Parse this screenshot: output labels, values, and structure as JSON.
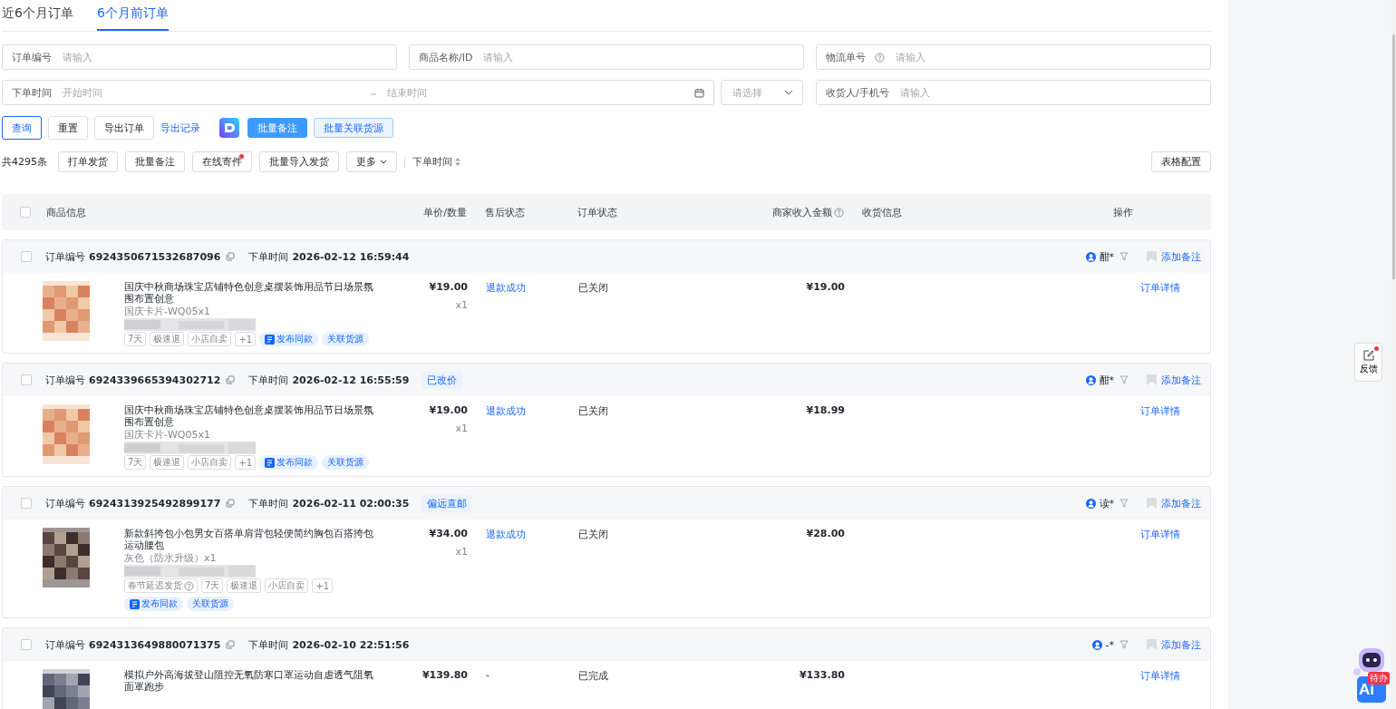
{
  "tabs": [
    {
      "label": "近6个月订单",
      "selected": false
    },
    {
      "label": "6个月前订单",
      "selected": true
    }
  ],
  "filter_rows": [
    [
      {
        "kind": "input",
        "label": "订单编号",
        "placeholder": "请输入"
      },
      {
        "kind": "input",
        "label": "商品名称/ID",
        "placeholder": "请输入"
      },
      {
        "kind": "input",
        "label": "物流单号",
        "placeholder": "请输入",
        "help": true
      }
    ],
    [
      {
        "kind": "daterange",
        "label": "下单时间",
        "placeholder": "开始时间",
        "end_placeholder": "结束时间"
      },
      {
        "kind": "select",
        "placeholder": "请选择"
      },
      {
        "kind": "input",
        "label": "收货人/手机号",
        "placeholder": "请输入"
      }
    ]
  ],
  "actions": [
    {
      "kind": "outline",
      "label": "查询"
    },
    {
      "kind": "default",
      "label": "重置"
    },
    {
      "kind": "default",
      "label": "导出订单"
    },
    {
      "kind": "link",
      "label": "导出记录"
    },
    {
      "kind": "app-icon"
    },
    {
      "kind": "primary",
      "label": "批量备注"
    },
    {
      "kind": "light",
      "label": "批量关联货源"
    }
  ],
  "toolbar": {
    "total": "共4295条",
    "buttons": [
      {
        "kind": "plain",
        "label": "打单发货"
      },
      {
        "kind": "plain",
        "label": "批量备注"
      },
      {
        "kind": "dot",
        "label": "在线寄件"
      },
      {
        "kind": "plain",
        "label": "批量导入发货"
      },
      {
        "kind": "dropdown",
        "label": "更多"
      }
    ],
    "sort": "下单时间",
    "config": "表格配置"
  },
  "table": {
    "select_all_checked": false,
    "columns": [
      {
        "label": "商品信息"
      },
      {
        "label": "单价/数量"
      },
      {
        "label": "售后状态"
      },
      {
        "label": "订单状态"
      },
      {
        "label": "商家收入金额",
        "help": true
      },
      {
        "label": "收货信息"
      },
      {
        "label": "操作"
      }
    ],
    "orders": [
      {
        "checked": false,
        "order_label": "订单编号",
        "order_no": "6924350671532687096",
        "time_label": "下单时间",
        "time": "2026-02-12 16:59:44",
        "buyer": "酣*",
        "note": "添加备注",
        "items": [
          {
            "title": "国庆中秋商场珠宝店铺特色创意桌摆装饰用品节日场景氛围布置创意",
            "sku": "国庆卡片-WQ05x1",
            "tags": [
              {
                "kind": "plain",
                "label": "7天"
              },
              {
                "kind": "plain",
                "label": "极速退"
              },
              {
                "kind": "plain",
                "label": "小店自卖"
              },
              {
                "kind": "count",
                "label": "+1"
              },
              {
                "kind": "publish",
                "label": "发布同款"
              },
              {
                "kind": "link",
                "label": "关联货源"
              }
            ],
            "price": "¥19.00",
            "qty": "x1",
            "after_sale": {
              "text": "退款成功",
              "link": true
            },
            "status": "已关闭",
            "income": "¥19.00",
            "action": "订单详情"
          }
        ]
      },
      {
        "checked": false,
        "order_label": "订单编号",
        "order_no": "6924339665394302712",
        "time_label": "下单时间",
        "time": "2026-02-12 16:55:59",
        "tag": "已改价",
        "buyer": "酣*",
        "note": "添加备注",
        "items": [
          {
            "title": "国庆中秋商场珠宝店铺特色创意桌摆装饰用品节日场景氛围布置创意",
            "sku": "国庆卡片-WQ05x1",
            "tags": [
              {
                "kind": "plain",
                "label": "7天"
              },
              {
                "kind": "plain",
                "label": "极速退"
              },
              {
                "kind": "plain",
                "label": "小店自卖"
              },
              {
                "kind": "count",
                "label": "+1"
              },
              {
                "kind": "publish",
                "label": "发布同款"
              },
              {
                "kind": "link",
                "label": "关联货源"
              }
            ],
            "price": "¥19.00",
            "qty": "x1",
            "after_sale": {
              "text": "退款成功",
              "link": true
            },
            "status": "已关闭",
            "income": "¥18.99",
            "action": "订单详情"
          }
        ]
      },
      {
        "checked": false,
        "order_label": "订单编号",
        "order_no": "6924313925492899177",
        "time_label": "下单时间",
        "time": "2026-02-11 02:00:35",
        "tag": "偏远直邮",
        "buyer": "读*",
        "note": "添加备注",
        "items": [
          {
            "title": "新款斜挎包小包男女百搭单肩背包轻便简约胸包百搭挎包运动腰包",
            "sku": "灰色（防水升级）x1",
            "tags": [
              {
                "kind": "help",
                "label": "春节延迟发货"
              },
              {
                "kind": "plain",
                "label": "7天"
              },
              {
                "kind": "plain",
                "label": "极速退"
              },
              {
                "kind": "plain",
                "label": "小店自卖"
              },
              {
                "kind": "count",
                "label": "+1"
              },
              {
                "kind": "publish",
                "label": "发布同款"
              },
              {
                "kind": "link",
                "label": "关联货源"
              }
            ],
            "price": "¥34.00",
            "qty": "x1",
            "after_sale": {
              "text": "退款成功",
              "link": true
            },
            "status": "已关闭",
            "income": "¥28.00",
            "action": "订单详情"
          }
        ]
      },
      {
        "checked": false,
        "order_label": "订单编号",
        "order_no": "6924313649880071375",
        "time_label": "下单时间",
        "time": "2026-02-10 22:51:56",
        "buyer": "-*",
        "note": "添加备注",
        "items": [
          {
            "title": "模拟户外高海拔登山阻控无氧防寒口罩运动自虐透气阻氧面罩跑步",
            "price": "¥139.80",
            "after_sale": {
              "text": "-",
              "link": false
            },
            "status": "已完成",
            "income": "¥133.80",
            "action": "订单详情"
          }
        ]
      }
    ]
  },
  "side": {
    "feedback": "反馈",
    "feedback_dot": true,
    "assistant_label": "Ai",
    "assistant_badge": "待办"
  }
}
